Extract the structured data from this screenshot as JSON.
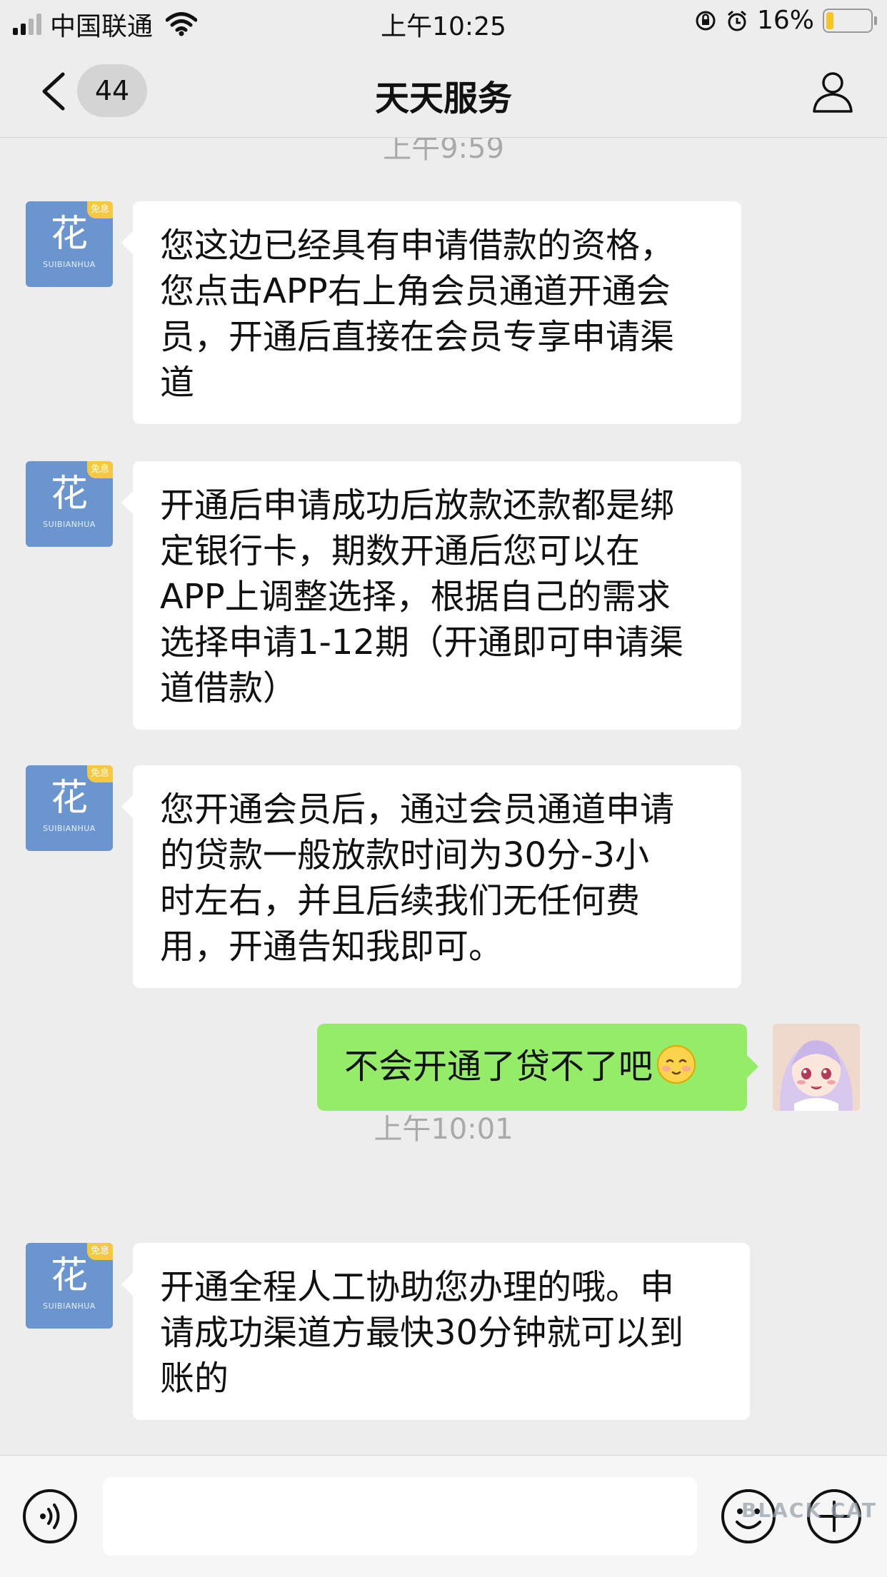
{
  "status_bar": {
    "carrier": "中国联通",
    "time": "上午10:25",
    "battery_percent": "16%",
    "battery_level": 0.16,
    "battery_color": "#f6c524"
  },
  "nav": {
    "back_icon": "chevron-left-icon",
    "unread_count": "44",
    "title": "天天服务",
    "profile_icon": "person-icon"
  },
  "chat": {
    "time_separators": [
      "上午9:59",
      "上午10:01"
    ],
    "bot_avatar": {
      "char": "花",
      "subtext": "SUIBIANHUA",
      "badge": "免息"
    },
    "messages": [
      {
        "sender": "bot",
        "lines": [
          "您这边已经具有申请借款的资格，",
          "您点击APP右上角会员通道开通会",
          "员，开通后直接在会员专享申请渠",
          "道"
        ]
      },
      {
        "sender": "bot",
        "lines": [
          "开通后申请成功后放款还款都是绑",
          "定银行卡，期数开通后您可以在",
          "APP上调整选择，根据自己的需求",
          "选择申请1-12期（开通即可申请渠",
          "道借款）"
        ]
      },
      {
        "sender": "bot",
        "lines": [
          "您开通会员后，通过会员通道申请",
          "的贷款一般放款时间为30分-3小",
          "时左右，并且后续我们无任何费",
          "用，开通告知我即可。"
        ]
      },
      {
        "sender": "user",
        "lines": [
          "不会开通了贷不了吧"
        ],
        "emoji": "smiling-face-emoji"
      },
      {
        "sender": "bot",
        "lines": [
          "开通全程人工协助您办理的哦。申",
          "请成功渠道方最快30分钟就可以到",
          "账的"
        ]
      }
    ]
  },
  "input_bar": {
    "voice_icon": "voice-icon",
    "emoji_icon": "emoji-icon",
    "plus_icon": "plus-icon",
    "watermark": "BLACK CAT"
  },
  "colors": {
    "background": "#ededed",
    "bubble_bot": "#ffffff",
    "bubble_user": "#95ec69",
    "bot_avatar": "#6b95cf"
  }
}
